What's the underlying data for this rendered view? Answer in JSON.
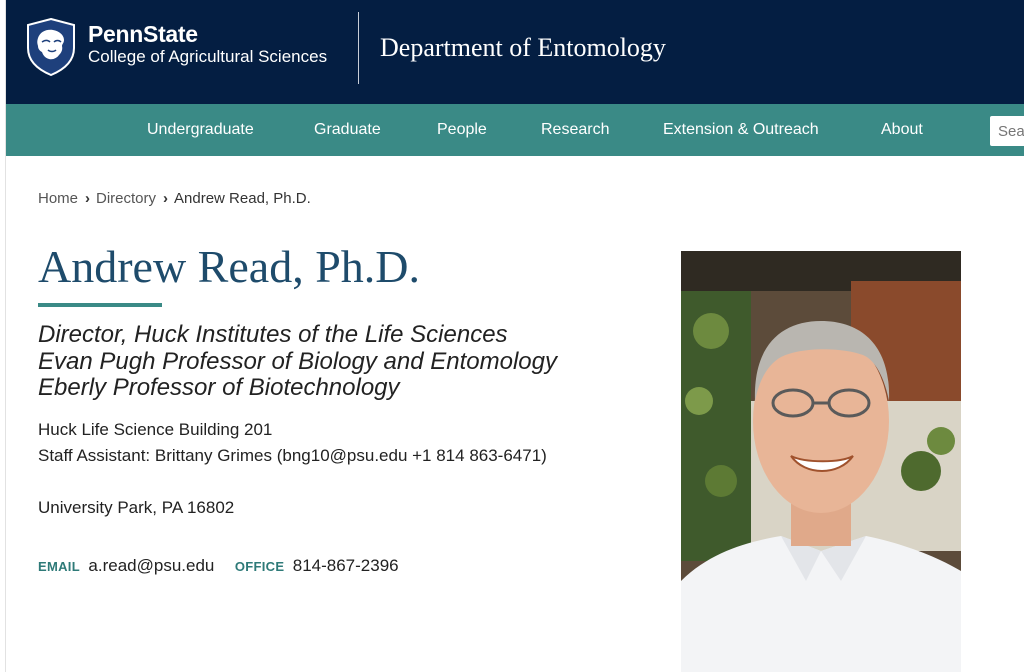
{
  "header": {
    "brand_name": "PennState",
    "college": "College of Agricultural Sciences",
    "department": "Department of Entomology",
    "logo_icon": "nittany-lion-shield-icon"
  },
  "nav": {
    "items": [
      {
        "label": "Undergraduate"
      },
      {
        "label": "Graduate"
      },
      {
        "label": "People"
      },
      {
        "label": "Research"
      },
      {
        "label": "Extension & Outreach"
      },
      {
        "label": "About"
      }
    ],
    "search_placeholder": "Search"
  },
  "breadcrumb": {
    "home": "Home",
    "directory": "Directory",
    "current": "Andrew Read, Ph.D.",
    "separator_icon": "chevron-right-icon"
  },
  "profile": {
    "name": "Andrew Read, Ph.D.",
    "titles": [
      "Director, Huck Institutes of the Life Sciences",
      "Evan Pugh Professor of Biology and Entomology",
      "Eberly Professor of Biotechnology"
    ],
    "building": "Huck Life Science Building 201",
    "staff_assistant": "Staff Assistant: Brittany Grimes (bng10@psu.edu +1 814 863-6471)",
    "city": "University Park, PA 16802",
    "email_label": "EMAIL",
    "email": "a.read@psu.edu",
    "office_label": "OFFICE",
    "office_phone": "814-867-2396"
  },
  "colors": {
    "header_bg": "#041E42",
    "nav_bg": "#3A8A86",
    "name_color": "#1E4B6B",
    "accent": "#3A8A86"
  }
}
